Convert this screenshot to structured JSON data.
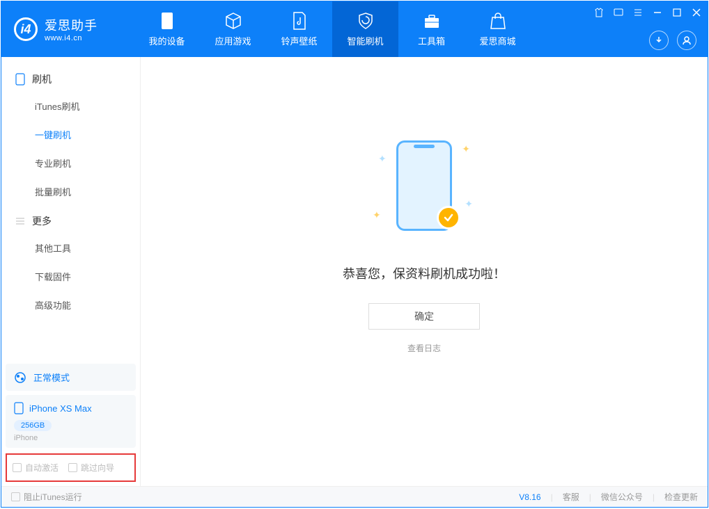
{
  "app": {
    "name": "爱思助手",
    "url": "www.i4.cn"
  },
  "nav": {
    "items": [
      {
        "label": "我的设备"
      },
      {
        "label": "应用游戏"
      },
      {
        "label": "铃声壁纸"
      },
      {
        "label": "智能刷机"
      },
      {
        "label": "工具箱"
      },
      {
        "label": "爱思商城"
      }
    ]
  },
  "sidebar": {
    "section1": "刷机",
    "flash_items": [
      {
        "label": "iTunes刷机"
      },
      {
        "label": "一键刷机"
      },
      {
        "label": "专业刷机"
      },
      {
        "label": "批量刷机"
      }
    ],
    "section2": "更多",
    "more_items": [
      {
        "label": "其他工具"
      },
      {
        "label": "下载固件"
      },
      {
        "label": "高级功能"
      }
    ],
    "mode": "正常模式",
    "device": {
      "name": "iPhone XS Max",
      "storage": "256GB",
      "type": "iPhone"
    },
    "checkbox1": "自动激活",
    "checkbox2": "跳过向导"
  },
  "main": {
    "success_title": "恭喜您，保资料刷机成功啦！",
    "confirm": "确定",
    "view_log": "查看日志"
  },
  "footer": {
    "stop_itunes": "阻止iTunes运行",
    "version": "V8.16",
    "link1": "客服",
    "link2": "微信公众号",
    "link3": "检查更新"
  }
}
